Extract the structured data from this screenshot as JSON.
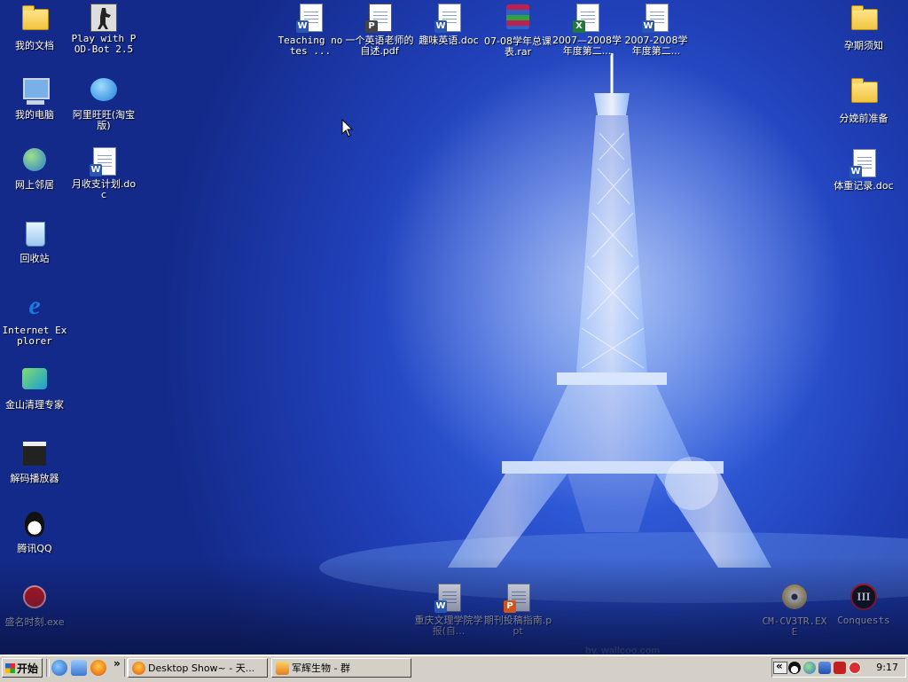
{
  "desktop": {
    "watermark": "by. wallcoo.com",
    "left_column": [
      {
        "label": "我的文档",
        "icon": "my-documents-icon"
      },
      {
        "label": "Play with POD-Bot 2.5",
        "icon": "counter-strike-icon"
      },
      {
        "label": "我的电脑",
        "icon": "my-computer-icon"
      },
      {
        "label": "阿里旺旺(淘宝版)",
        "icon": "aliwangwang-icon"
      },
      {
        "label": "网上邻居",
        "icon": "network-places-icon"
      },
      {
        "label": "月收支计划.doc",
        "icon": "word-document-icon"
      },
      {
        "label": "回收站",
        "icon": "recycle-bin-icon"
      },
      {
        "label": "Internet Explorer",
        "icon": "internet-explorer-icon"
      },
      {
        "label": "金山清理专家",
        "icon": "kingsoft-cleaner-icon"
      },
      {
        "label": "解码播放器",
        "icon": "media-player-icon"
      },
      {
        "label": "腾讯QQ",
        "icon": "qq-penguin-icon"
      },
      {
        "label": "盛名时刻.exe",
        "icon": "app-exe-icon"
      }
    ],
    "top_row": [
      {
        "label": "Teaching notes ...",
        "icon": "word-document-icon"
      },
      {
        "label": "一个英语老师的自述.pdf",
        "icon": "pdf-document-icon"
      },
      {
        "label": "趣味英语.doc",
        "icon": "word-document-icon"
      },
      {
        "label": "07-08学年总课表.rar",
        "icon": "winrar-archive-icon"
      },
      {
        "label": "2007—2008学年度第二...",
        "icon": "excel-document-icon"
      },
      {
        "label": "2007-2008学年度第二...",
        "icon": "word-document-icon"
      }
    ],
    "right_column": [
      {
        "label": "孕期须知",
        "icon": "folder-icon"
      },
      {
        "label": "分娩前准备",
        "icon": "folder-icon"
      },
      {
        "label": "体重记录.doc",
        "icon": "word-document-icon"
      }
    ],
    "bottom_row": [
      {
        "label": "重庆文理学院学报(自...",
        "icon": "word-document-icon"
      },
      {
        "label": "期刊投稿指南.ppt",
        "icon": "powerpoint-document-icon"
      },
      {
        "label": "CM-CV3TR.EXE",
        "icon": "cd-installer-icon"
      },
      {
        "label": "Conquests",
        "icon": "civilization-iii-icon"
      }
    ]
  },
  "taskbar": {
    "start_label": "开始",
    "quick_launch_more": "»",
    "tasks": [
      {
        "label": "Desktop Show~ - 天...",
        "icon": "firefox-icon"
      },
      {
        "label": "军辉生物 - 群",
        "icon": "qq-group-icon"
      }
    ],
    "tray_more": "«",
    "clock": "9:17"
  },
  "colors": {
    "desktop_blue": "#2f5ad8",
    "taskbar_gray": "#d4d0c8"
  }
}
